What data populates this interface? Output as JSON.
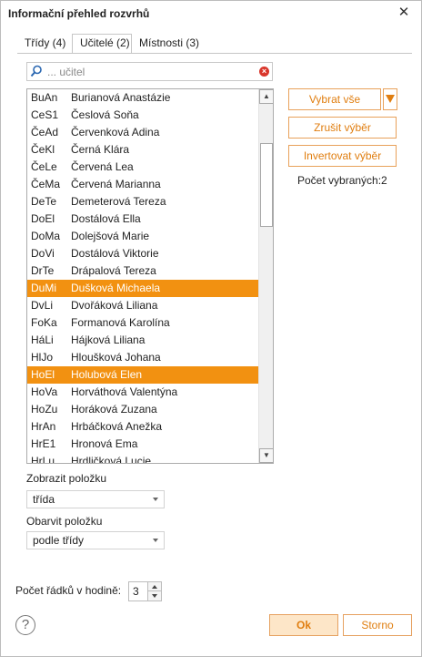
{
  "window": {
    "title": "Informační přehled rozvrhů"
  },
  "tabs": [
    {
      "label": "Třídy (4)"
    },
    {
      "label": "Učitelé (2)"
    },
    {
      "label": "Místnosti (3)"
    }
  ],
  "search": {
    "placeholder": "... učitel",
    "value": ""
  },
  "list": {
    "items": [
      {
        "code": "BuAn",
        "name": "Burianová Anastázie",
        "selected": false
      },
      {
        "code": "CeS1",
        "name": "Česlová Soňa",
        "selected": false
      },
      {
        "code": "ČeAd",
        "name": "Červenková Adina",
        "selected": false
      },
      {
        "code": "ČeKl",
        "name": "Černá Klára",
        "selected": false
      },
      {
        "code": "ČeLe",
        "name": "Červená Lea",
        "selected": false
      },
      {
        "code": "ČeMa",
        "name": "Červená Marianna",
        "selected": false
      },
      {
        "code": "DeTe",
        "name": "Demeterová Tereza",
        "selected": false
      },
      {
        "code": "DoEl",
        "name": "Dostálová Ella",
        "selected": false
      },
      {
        "code": "DoMa",
        "name": "Dolejšová Marie",
        "selected": false
      },
      {
        "code": "DoVi",
        "name": "Dostálová Viktorie",
        "selected": false
      },
      {
        "code": "DrTe",
        "name": "Drápalová Tereza",
        "selected": false
      },
      {
        "code": "DuMi",
        "name": "Dušková Michaela",
        "selected": true
      },
      {
        "code": "DvLi",
        "name": "Dvořáková Liliana",
        "selected": false
      },
      {
        "code": "FoKa",
        "name": "Formanová Karolína",
        "selected": false
      },
      {
        "code": "HáLi",
        "name": "Hájková Liliana",
        "selected": false
      },
      {
        "code": "HlJo",
        "name": "Hloušková Johana",
        "selected": false
      },
      {
        "code": "HoEl",
        "name": "Holubová Elen",
        "selected": true
      },
      {
        "code": "HoVa",
        "name": "Horváthová Valentýna",
        "selected": false
      },
      {
        "code": "HoZu",
        "name": "Horáková Zuzana",
        "selected": false
      },
      {
        "code": "HrAn",
        "name": "Hrbáčková Anežka",
        "selected": false
      },
      {
        "code": "HrE1",
        "name": "Hronová Ema",
        "selected": false
      },
      {
        "code": "HrLu",
        "name": "Hrdličková Lucie",
        "selected": false
      }
    ]
  },
  "actions": {
    "select_all": "Vybrat vše",
    "clear_selection": "Zrušit výběr",
    "invert_selection": "Invertovat výběr",
    "selected_count_label": "Počet vybraných:",
    "selected_count_value": "2"
  },
  "display_item": {
    "label": "Zobrazit položku",
    "value": "třída"
  },
  "color_item": {
    "label": "Obarvit položku",
    "value": "podle třídy"
  },
  "rows_per_hour": {
    "label": "Počet řádků v hodině:",
    "value": "3"
  },
  "footer": {
    "ok": "Ok",
    "cancel": "Storno",
    "help": "?"
  },
  "colors": {
    "accent": "#f29111",
    "accent_text": "#e07e10",
    "clear_icon": "#d9362b"
  }
}
